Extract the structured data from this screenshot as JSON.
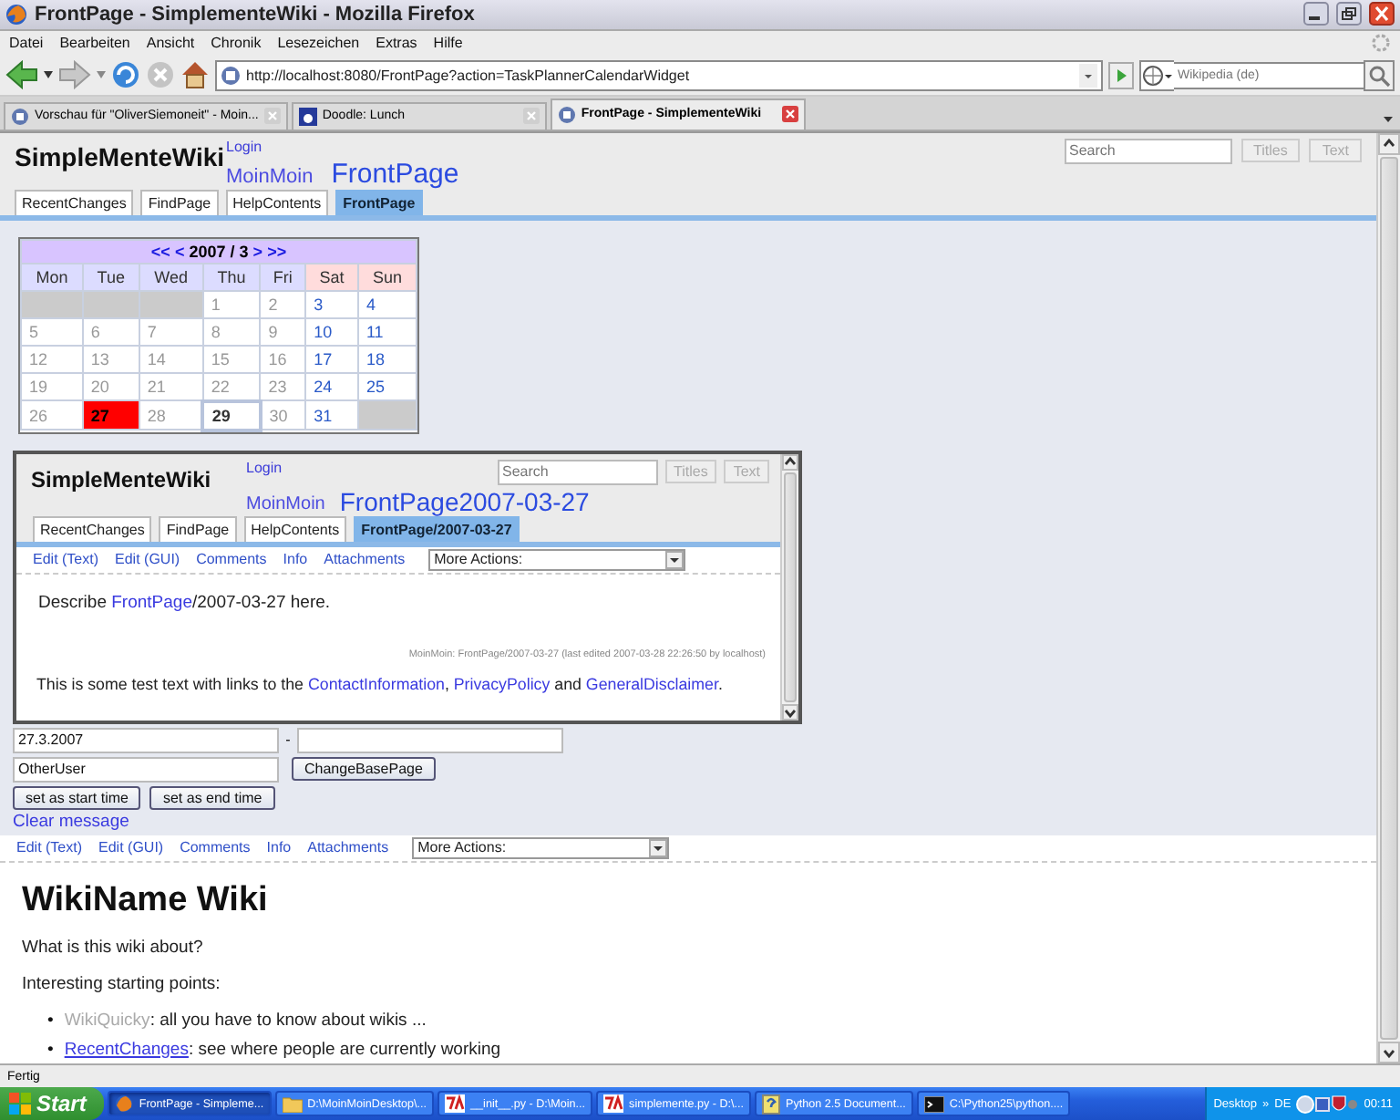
{
  "window": {
    "title": "FrontPage - SimplementeWiki - Mozilla Firefox"
  },
  "menu": [
    "Datei",
    "Bearbeiten",
    "Ansicht",
    "Chronik",
    "Lesezeichen",
    "Extras",
    "Hilfe"
  ],
  "toolbar": {
    "url": "http://localhost:8080/FrontPage?action=TaskPlannerCalendarWidget",
    "search_placeholder": "Wikipedia (de)"
  },
  "browser_tabs": [
    {
      "label": "Vorschau für \"OliverSiemoneit\" - Moin...",
      "selected": false
    },
    {
      "label": "Doodle: Lunch",
      "selected": false
    },
    {
      "label": "FrontPage - SimplementeWiki",
      "selected": true
    }
  ],
  "wiki": {
    "logo": "SimpleMenteWiki",
    "login": "Login",
    "breadcrumb": "MoinMoin",
    "page_title": "FrontPage",
    "search_placeholder": "Search",
    "search_buttons": [
      "Titles",
      "Text"
    ],
    "nav_tabs": [
      {
        "label": "RecentChanges",
        "selected": false
      },
      {
        "label": "FindPage",
        "selected": false
      },
      {
        "label": "HelpContents",
        "selected": false
      },
      {
        "label": "FrontPage",
        "selected": true
      }
    ]
  },
  "calendar": {
    "prev": [
      "<<",
      "<"
    ],
    "title": "2007 / 3",
    "next": [
      ">",
      ">>"
    ],
    "weekdays": [
      {
        "label": "Mon",
        "kind": "workday"
      },
      {
        "label": "Tue",
        "kind": "workday"
      },
      {
        "label": "Wed",
        "kind": "workday"
      },
      {
        "label": "Thu",
        "kind": "workday"
      },
      {
        "label": "Fri",
        "kind": "workday"
      },
      {
        "label": "Sat",
        "kind": "weekend"
      },
      {
        "label": "Sun",
        "kind": "weekend"
      }
    ],
    "weeks": [
      [
        {
          "kind": "blank"
        },
        {
          "kind": "blank"
        },
        {
          "kind": "blank"
        },
        {
          "day": "1",
          "kind": "plain"
        },
        {
          "day": "2",
          "kind": "plain"
        },
        {
          "day": "3",
          "kind": "weekend"
        },
        {
          "day": "4",
          "kind": "weekend"
        }
      ],
      [
        {
          "day": "5",
          "kind": "plain"
        },
        {
          "day": "6",
          "kind": "plain"
        },
        {
          "day": "7",
          "kind": "plain"
        },
        {
          "day": "8",
          "kind": "plain"
        },
        {
          "day": "9",
          "kind": "plain"
        },
        {
          "day": "10",
          "kind": "weekend"
        },
        {
          "day": "11",
          "kind": "weekend"
        }
      ],
      [
        {
          "day": "12",
          "kind": "plain"
        },
        {
          "day": "13",
          "kind": "plain"
        },
        {
          "day": "14",
          "kind": "plain"
        },
        {
          "day": "15",
          "kind": "plain"
        },
        {
          "day": "16",
          "kind": "plain"
        },
        {
          "day": "17",
          "kind": "weekend"
        },
        {
          "day": "18",
          "kind": "weekend"
        }
      ],
      [
        {
          "day": "19",
          "kind": "plain"
        },
        {
          "day": "20",
          "kind": "plain"
        },
        {
          "day": "21",
          "kind": "plain"
        },
        {
          "day": "22",
          "kind": "plain"
        },
        {
          "day": "23",
          "kind": "plain"
        },
        {
          "day": "24",
          "kind": "weekend"
        },
        {
          "day": "25",
          "kind": "weekend"
        }
      ],
      [
        {
          "day": "26",
          "kind": "plain"
        },
        {
          "day": "27",
          "kind": "selected"
        },
        {
          "day": "28",
          "kind": "plain"
        },
        {
          "day": "29",
          "kind": "today"
        },
        {
          "day": "30",
          "kind": "plain"
        },
        {
          "day": "31",
          "kind": "weekend"
        },
        {
          "kind": "blank"
        }
      ]
    ]
  },
  "frame": {
    "logo": "SimpleMenteWiki",
    "login": "Login",
    "breadcrumb": "MoinMoin",
    "page_title": "FrontPage2007-03-27",
    "search_placeholder": "Search",
    "search_buttons": [
      "Titles",
      "Text"
    ],
    "nav_tabs": [
      {
        "label": "RecentChanges",
        "selected": false
      },
      {
        "label": "FindPage",
        "selected": false
      },
      {
        "label": "HelpContents",
        "selected": false
      },
      {
        "label": "FrontPage/2007-03-27",
        "selected": true
      }
    ],
    "actions": [
      "Edit (Text)",
      "Edit (GUI)",
      "Comments",
      "Info",
      "Attachments"
    ],
    "more_actions": "More Actions:",
    "body": [
      {
        "text": "Describe ",
        "kind": "text"
      },
      {
        "text": "FrontPage",
        "kind": "link"
      },
      {
        "text": "/2007-03-27 here.",
        "kind": "text"
      }
    ],
    "footer": "MoinMoin: FrontPage/2007-03-27 (last edited 2007-03-28 22:26:50 by localhost)",
    "overlay_text": [
      {
        "text": "This is some test text with links to the ",
        "kind": "text"
      },
      {
        "text": "ContactInformation",
        "kind": "link",
        "after": ", "
      },
      {
        "text": "PrivacyPolicy",
        "kind": "link",
        "after": " and "
      },
      {
        "text": "GeneralDisclaimer",
        "kind": "link",
        "after": "."
      }
    ]
  },
  "form": {
    "start_date": "27.3.2007",
    "separator": "-",
    "user": "OtherUser",
    "change_button": "ChangeBasePage",
    "buttons": [
      "set as start time",
      "set as end time"
    ],
    "clear_link": "Clear message"
  },
  "actions": [
    "Edit (Text)",
    "Edit (GUI)",
    "Comments",
    "Info",
    "Attachments"
  ],
  "more_actions": "More Actions:",
  "content": {
    "heading": "WikiName Wiki",
    "paragraphs": [
      "What is this wiki about?",
      "Interesting starting points:"
    ],
    "list": [
      {
        "bullet": "•",
        "link": "WikiQuicky",
        "exists": false,
        "text": ": all you have to know about wikis ..."
      },
      {
        "bullet": "•",
        "link": "RecentChanges",
        "exists": true,
        "text": ": see where people are currently working"
      }
    ]
  },
  "status_bar": "Fertig",
  "taskbar": {
    "start": "Start",
    "tasks": [
      {
        "label": "FrontPage - Simpleme...",
        "kind": "browser",
        "selected": true
      },
      {
        "label": "D:\\MoinMoinDesktop\\...",
        "kind": "folder",
        "selected": false
      },
      {
        "label": "__init__.py - D:\\Moin...",
        "kind": "editor",
        "selected": false
      },
      {
        "label": "simplemente.py - D:\\...",
        "kind": "editor",
        "selected": false
      },
      {
        "label": "Python 2.5 Document...",
        "kind": "help",
        "selected": false
      },
      {
        "label": "C:\\Python25\\python....",
        "kind": "console",
        "selected": false
      }
    ],
    "tray_label": "Desktop",
    "tray_more": "»",
    "language": "DE",
    "clock": "00:11"
  }
}
